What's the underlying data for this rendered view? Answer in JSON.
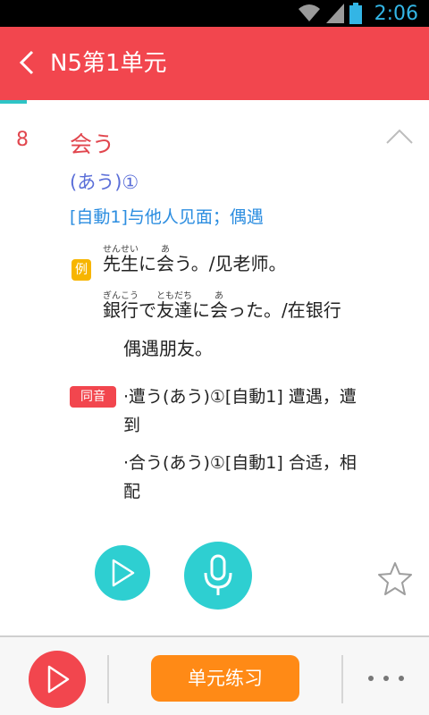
{
  "status_bar": {
    "time": "2:06"
  },
  "header": {
    "title": "N5第1单元"
  },
  "progress": {
    "fraction": 0.0625
  },
  "word": {
    "index": "8",
    "kanji": "会う",
    "reading": "(あう)①",
    "meaning": "[自動1]与他人见面；偶遇"
  },
  "example_tag": "例",
  "examples": {
    "ex1": {
      "w1": "先生",
      "r1": "せんせい",
      "p1": "に",
      "w2": "会",
      "r2": "あ",
      "p2": "う。/见老师。"
    },
    "ex2": {
      "w1": "銀行",
      "r1": "ぎんこう",
      "p1": "で",
      "w2": "友達",
      "r2": "ともだち",
      "p2": "に",
      "w3": "会",
      "r3": "あ",
      "p3": "った。/在银行",
      "cont": "偶遇朋友。"
    }
  },
  "homophone_tag": "同音",
  "homophones": [
    {
      "line1": "·遭う(あう)①[自動1] 遭遇，遭",
      "line2": "到"
    },
    {
      "line1": "·合う(あう)①[自動1] 合适，相",
      "line2": "配"
    }
  ],
  "bottom_bar": {
    "practice_label": "单元练习"
  },
  "colors": {
    "brand_red": "#f2464e",
    "accent_teal": "#2ecfd1",
    "practice_orange": "#ff8a16",
    "reading_blue": "#5a6ed8",
    "meaning_blue": "#2b8de0",
    "example_yellow": "#f7b500"
  }
}
